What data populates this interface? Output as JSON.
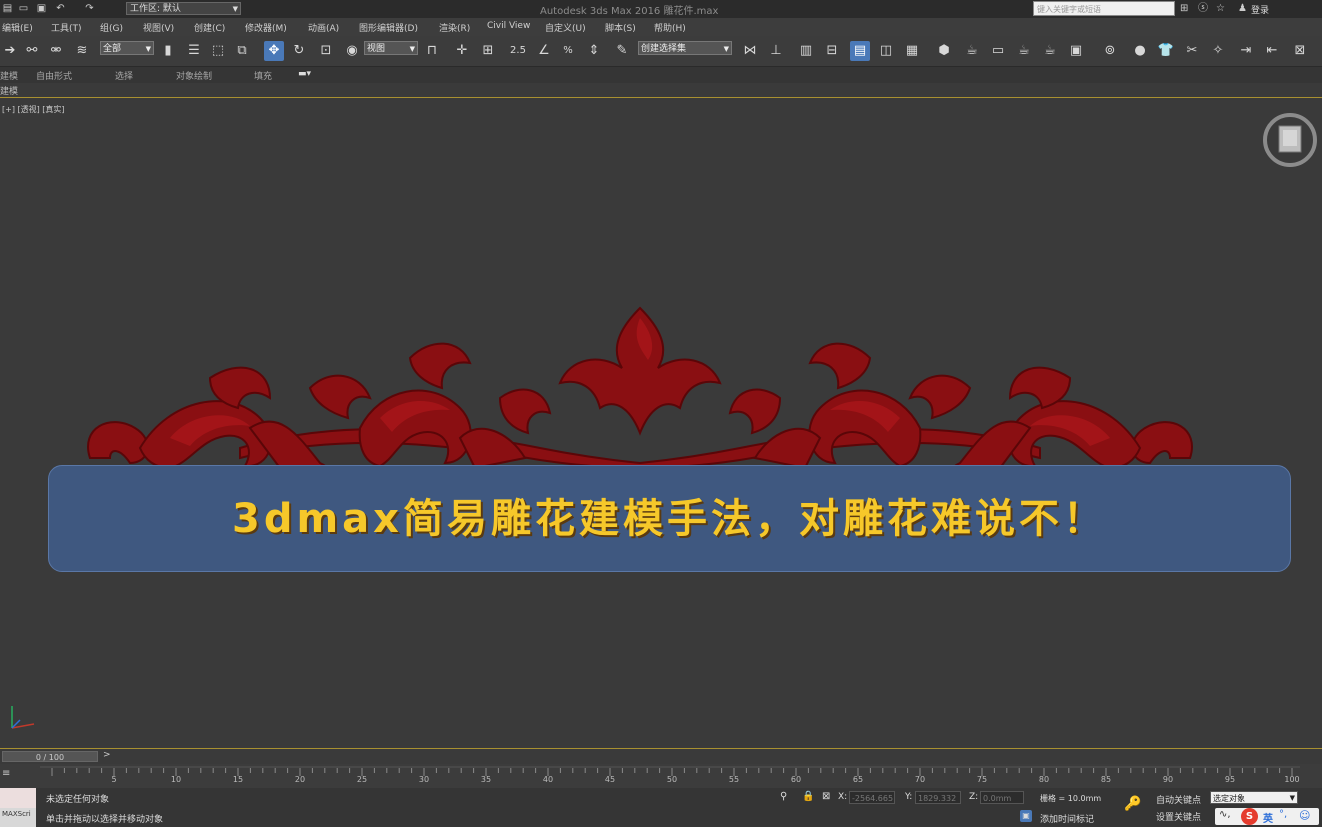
{
  "titlebar": {
    "workspace_label": "工作区: 默认",
    "app_title": "Autodesk 3ds Max 2016    雕花件.max",
    "search_placeholder": "键入关键字或短语",
    "login_label": "登录"
  },
  "menubar": {
    "items": [
      "编辑(E)",
      "工具(T)",
      "组(G)",
      "视图(V)",
      "创建(C)",
      "修改器(M)",
      "动画(A)",
      "图形编辑器(D)",
      "渲染(R)",
      "Civil View",
      "自定义(U)",
      "脚本(S)",
      "帮助(H)"
    ]
  },
  "toolbar": {
    "filter_value": "全部",
    "refcoord_value": "视图",
    "named_selection_value": "创建选择集"
  },
  "ribbon": {
    "tabs": [
      "建模",
      "自由形式",
      "选择",
      "对象绘制",
      "填充"
    ],
    "sub_label": "建模"
  },
  "viewport": {
    "label": "[+] [透视] [真实]",
    "banner_text": "3dmax简易雕花建模手法，对雕花难说不！",
    "ornament_color": "#8a0f12",
    "banner_color": "#3f5880",
    "banner_text_color": "#f6c82a"
  },
  "timeline": {
    "frame_label": "0 / 100",
    "arrow_label": ">",
    "ticks": [
      5,
      10,
      15,
      20,
      25,
      30,
      35,
      40,
      45,
      50,
      55,
      60,
      65,
      70,
      75,
      80,
      85,
      90,
      95,
      100
    ]
  },
  "statusbar": {
    "maxscript_label": "MAXScri",
    "selection_status": "未选定任何对象",
    "prompt": "单击并拖动以选择并移动对象",
    "x_label": "X:",
    "x_value": "-2564.665",
    "y_label": "Y:",
    "y_value": "1829.332",
    "z_label": "Z:",
    "z_value": "0.0mm",
    "grid_label": "栅格 = 10.0mm",
    "add_time_tag": "添加时间标记",
    "auto_key": "自动关键点",
    "set_key": "设置关键点",
    "selected_object": "选定对象",
    "ime_label": "英"
  }
}
